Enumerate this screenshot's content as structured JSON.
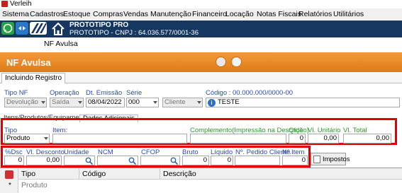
{
  "window": {
    "title": "Verleih"
  },
  "menu": [
    "Sistema",
    "Cadastros",
    "Estoque",
    "Compras",
    "Vendas",
    "Manutenção",
    "Financeiro",
    "Locação",
    "Notas Fiscais",
    "Relatórios",
    "Utilitários"
  ],
  "company": {
    "product": "PROTOTIPO PRO",
    "line": "PROTOTIPO - CNPJ : 64.036.577/0001-36"
  },
  "main_tab": "NF Avulsa",
  "form_title": "NF Avulsa",
  "subtab": "Incluindo Registro",
  "header": {
    "tipo_nf": {
      "label": "Tipo NF",
      "value": "Devolução"
    },
    "operacao": {
      "label": "Operação",
      "value": "Saída"
    },
    "dt_emissao": {
      "label": "Dt. Emissão",
      "value": "08/04/2022"
    },
    "serie": {
      "label": "Série",
      "value": "000"
    },
    "destinatario_tipo": {
      "value": "Cliente"
    },
    "codigo": {
      "label": "Código : 00.000.000/0000-00",
      "value": "TESTE"
    }
  },
  "section_tabs": [
    "Itens/Produtos/Equipamentos",
    "Dados Adicionais"
  ],
  "item_row": {
    "tipo": {
      "label": "Tipo",
      "value": "Produto"
    },
    "item": {
      "label": "Item:",
      "value": ""
    },
    "complemento": {
      "label": "Complemento(Impressão na Descrição)",
      "value": ""
    },
    "qtde": {
      "label": "Qtde",
      "value": "0"
    },
    "vl_unitario": {
      "label": "Vl. Unitário",
      "value": "0,00"
    },
    "vl_total": {
      "label": "Vl. Total",
      "value": "0,00"
    }
  },
  "fiscal_row": {
    "pct_desc": {
      "label": "%Dsc",
      "value": "0"
    },
    "vl_desconto": {
      "label": "Vl. Desconto",
      "value": "0,00"
    },
    "unidade": {
      "label": "Unidade",
      "value": ""
    },
    "ncm": {
      "label": "NCM",
      "value": ""
    },
    "cfop": {
      "label": "CFOP",
      "value": ""
    },
    "bruto": {
      "label": "Bruto",
      "value": "0"
    },
    "liquido": {
      "label": "Líquido",
      "value": "0"
    },
    "pedido_cliente": {
      "label": "Nº. Pedido Cliente",
      "value": ""
    },
    "n_item": {
      "label": "Nº.Item",
      "value": "0"
    }
  },
  "impostos_button": "Impostos",
  "grid": {
    "columns": [
      "Tipo",
      "Código",
      "Descrição"
    ],
    "rows": [
      {
        "tipo": "Produto"
      }
    ]
  },
  "colors": {
    "accent_orange": "#e8851f",
    "navy": "#16375f",
    "highlight_red": "#e00000"
  }
}
